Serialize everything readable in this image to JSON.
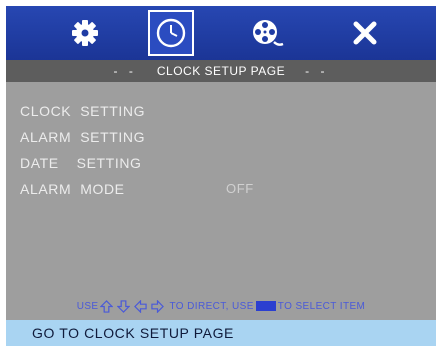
{
  "tabs": [
    {
      "icon": "gear-icon",
      "active": false
    },
    {
      "icon": "clock-icon",
      "active": true
    },
    {
      "icon": "film-reel-icon",
      "active": false
    },
    {
      "icon": "close-icon",
      "active": false
    }
  ],
  "page_bar": {
    "left_dashes": "- -",
    "title": "CLOCK SETUP PAGE",
    "right_dashes": "- -"
  },
  "menu": {
    "items": [
      {
        "label": "CLOCK  SETTING",
        "value": ""
      },
      {
        "label": "ALARM  SETTING",
        "value": ""
      },
      {
        "label": "DATE    SETTING",
        "value": ""
      },
      {
        "label": "ALARM  MODE",
        "value": "OFF"
      }
    ]
  },
  "hint": {
    "use": "USE",
    "to_direct": "TO DIRECT, USE",
    "to_select": "TO SELECT ITEM"
  },
  "status": {
    "text": "GO TO CLOCK SETUP PAGE"
  },
  "colors": {
    "icon_bar": "#1f3ca4",
    "page_bar": "#5d5d5d",
    "background": "#9e9e9e",
    "status_bar": "#a9d4f2",
    "hint_text": "#4a5ad8"
  }
}
